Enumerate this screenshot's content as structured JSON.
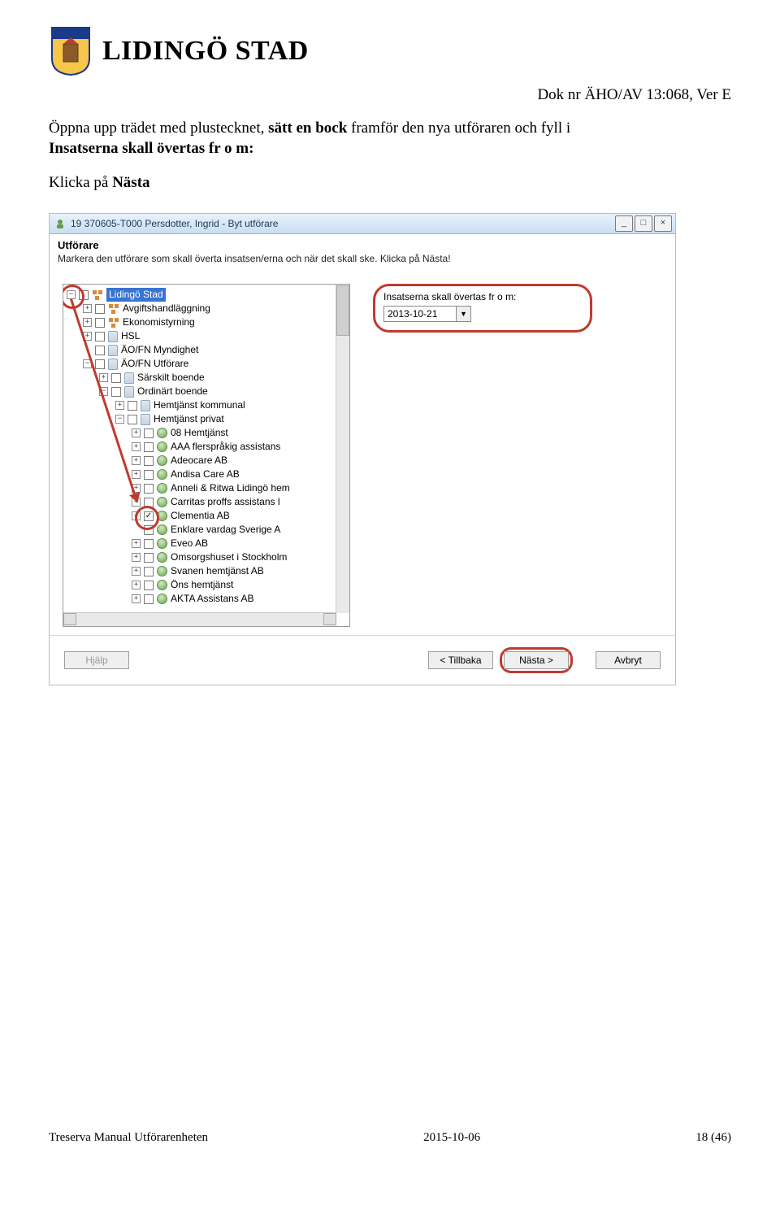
{
  "header": {
    "brand": "LIDINGÖ STAD",
    "docnr": "Dok nr ÄHO/AV 13:068, Ver E"
  },
  "body": {
    "line1_a": "Öppna upp trädet med plustecknet, ",
    "line1_b": "sätt en bock",
    "line1_c": " framför den nya utföraren och fyll i",
    "line2a": "Insatserna skall övertas fr o m:",
    "line3a": "Klicka på ",
    "line3b": "Nästa"
  },
  "window": {
    "title": "19 370605-T000 Persdotter, Ingrid - Byt utförare",
    "section_title": "Utförare",
    "instruction": "Markera den utförare som skall överta insatsen/erna och när det skall ske. Klicka på Nästa!",
    "date_label": "Insatserna skall övertas fr o m:",
    "date_value": "2013-10-21",
    "buttons": {
      "help": "Hjälp",
      "back": "< Tillbaka",
      "next": "Nästa >",
      "cancel": "Avbryt"
    },
    "tree": {
      "root": "Lidingö Stad",
      "n0": "Avgiftshandläggning",
      "n1": "Ekonomistyrning",
      "n2": "HSL",
      "n3": "ÄO/FN Myndighet",
      "n4": "ÄO/FN Utförare",
      "n5": "Särskilt boende",
      "n6": "Ordinärt boende",
      "n7": "Hemtjänst kommunal",
      "n8": "Hemtjänst privat",
      "p0": "08 Hemtjänst",
      "p1": "AAA flerspråkig assistans",
      "p2": "Adeocare AB",
      "p3": "Andisa Care AB",
      "p4": "Anneli & Ritwa Lidingö hem",
      "p5": "Carritas proffs assistans l",
      "p6": "Clementia AB",
      "p7": "Enklare vardag Sverige A",
      "p8": "Eveo AB",
      "p9": "Omsorgshuset i Stockholm",
      "p10": "Svanen hemtjänst AB",
      "p11": "Öns hemtjänst",
      "p12": "AKTA Assistans AB"
    }
  },
  "footer": {
    "left": "Treserva Manual Utförarenheten",
    "center": "2015-10-06",
    "right": "18 (46)"
  }
}
